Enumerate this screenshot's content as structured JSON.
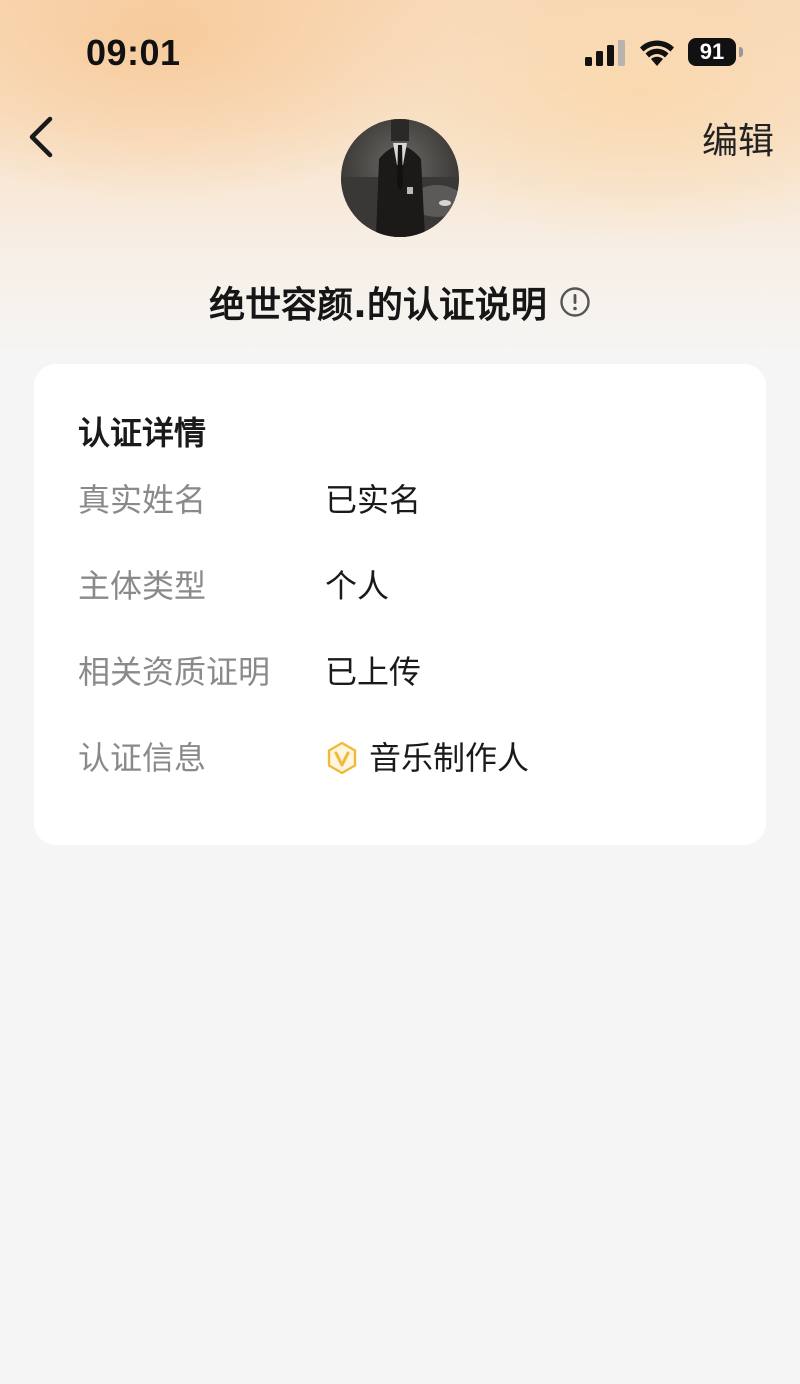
{
  "status_bar": {
    "time": "09:01",
    "battery": "91",
    "signal_icon": "cellular-signal-icon",
    "wifi_icon": "wifi-icon"
  },
  "nav": {
    "back_icon": "chevron-left-icon",
    "edit_label": "编辑"
  },
  "profile": {
    "avatar": "user-avatar",
    "title": "绝世容颜.的认证说明",
    "info_icon": "info-circle-icon"
  },
  "card": {
    "title": "认证详情",
    "rows": [
      {
        "label": "真实姓名",
        "value": "已实名"
      },
      {
        "label": "主体类型",
        "value": "个人"
      },
      {
        "label": "相关资质证明",
        "value": "已上传"
      },
      {
        "label": "认证信息",
        "value": "音乐制作人",
        "badge_icon": "v-verified-badge-icon"
      }
    ]
  },
  "colors": {
    "accent_gold": "#f0b93a",
    "header_gradient": "#f8d9b8",
    "background": "#f6f5f5"
  }
}
